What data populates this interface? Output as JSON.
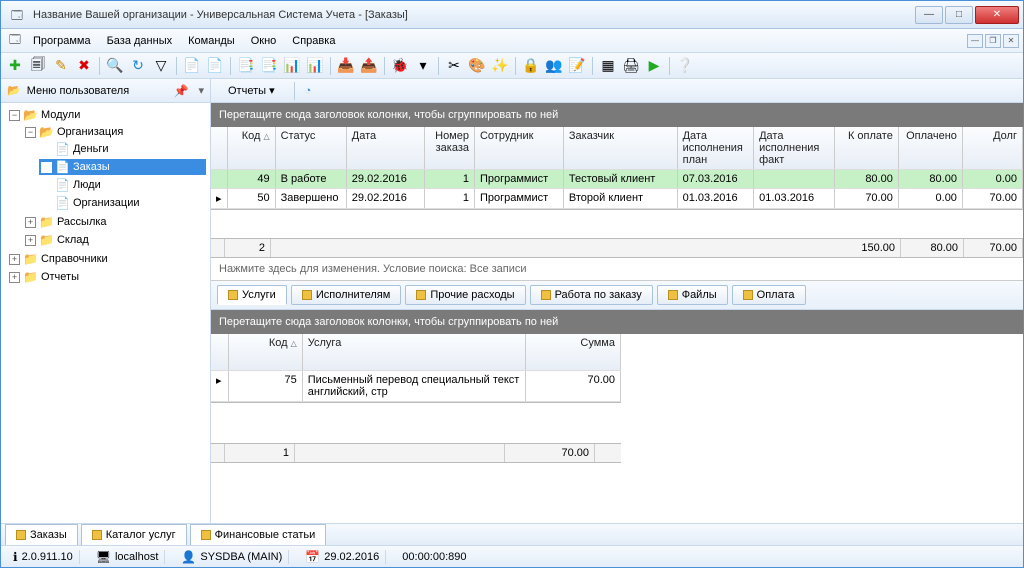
{
  "window": {
    "title": "Название Вашей организации - Универсальная Система Учета - [Заказы]"
  },
  "menu": {
    "program": "Программа",
    "database": "База данных",
    "commands": "Команды",
    "window": "Окно",
    "help": "Справка"
  },
  "usermenu": {
    "title": "Меню пользователя"
  },
  "tree": {
    "modules": "Модули",
    "organization": "Организация",
    "money": "Деньги",
    "orders": "Заказы",
    "people": "Люди",
    "orgs": "Организации",
    "mailing": "Рассылка",
    "stock": "Склад",
    "refs": "Справочники",
    "reports": "Отчеты"
  },
  "reports_bar": {
    "label": "Отчеты ▾"
  },
  "groupbar": {
    "text": "Перетащите сюда заголовок колонки, чтобы сгруппировать по ней"
  },
  "columns": {
    "code": "Код",
    "status": "Статус",
    "date": "Дата",
    "orderno": "Номер заказа",
    "employee": "Сотрудник",
    "customer": "Заказчик",
    "plan": "Дата исполнения план",
    "fact": "Дата исполнения факт",
    "topay": "К оплате",
    "paid": "Оплачено",
    "debt": "Долг"
  },
  "rows": [
    {
      "code": "49",
      "status": "В работе",
      "date": "29.02.2016",
      "orderno": "1",
      "employee": "Программист",
      "customer": "Тестовый клиент",
      "plan": "07.03.2016",
      "fact": "",
      "topay": "80.00",
      "paid": "80.00",
      "debt": "0.00",
      "highlight": true
    },
    {
      "code": "50",
      "status": "Завершено",
      "date": "29.02.2016",
      "orderno": "1",
      "employee": "Программист",
      "customer": "Второй клиент",
      "plan": "01.03.2016",
      "fact": "01.03.2016",
      "topay": "70.00",
      "paid": "0.00",
      "debt": "70.00",
      "highlight": false
    }
  ],
  "summary": {
    "count": "2",
    "topay": "150.00",
    "paid": "80.00",
    "debt": "70.00"
  },
  "search_hint": "Нажмите здесь для изменения. Условие поиска: Все записи",
  "detail_tabs": {
    "services": "Услуги",
    "performers": "Исполнителям",
    "expenses": "Прочие расходы",
    "workorder": "Работа по заказу",
    "files": "Файлы",
    "payment": "Оплата"
  },
  "detail_columns": {
    "code": "Код",
    "service": "Услуга",
    "sum": "Сумма"
  },
  "detail_rows": [
    {
      "code": "75",
      "service": "Письменный перевод специальный текст английский, стр",
      "sum": "70.00"
    }
  ],
  "detail_summary": {
    "count": "1",
    "sum": "70.00"
  },
  "bottom_tabs": {
    "orders": "Заказы",
    "catalog": "Каталог услуг",
    "fin": "Финансовые статьи"
  },
  "status": {
    "version": "2.0.911.10",
    "host": "localhost",
    "user": "SYSDBA (MAIN)",
    "date": "29.02.2016",
    "time": "00:00:00:890"
  }
}
